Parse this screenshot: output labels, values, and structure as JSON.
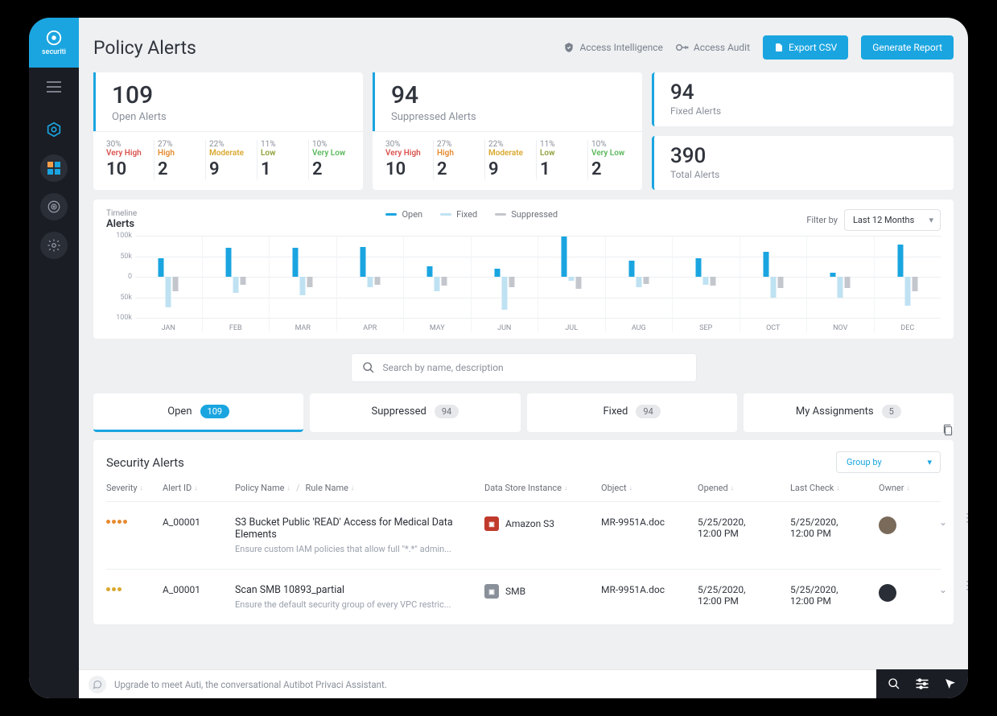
{
  "brand": "securiti",
  "page_title": "Policy Alerts",
  "header_links": {
    "access_intelligence": "Access Intelligence",
    "access_audit": "Access Audit"
  },
  "buttons": {
    "export_csv": "Export CSV",
    "generate_report": "Generate Report"
  },
  "summary": {
    "open": {
      "value": "109",
      "label": "Open Alerts"
    },
    "suppressed": {
      "value": "94",
      "label": "Suppressed Alerts"
    },
    "fixed": {
      "value": "94",
      "label": "Fixed Alerts"
    },
    "total": {
      "value": "390",
      "label": "Total Alerts"
    }
  },
  "severity_levels": [
    {
      "pct": "30%",
      "name": "Very High",
      "value": "10",
      "class": "c-veryhigh"
    },
    {
      "pct": "27%",
      "name": "High",
      "value": "2",
      "class": "c-high"
    },
    {
      "pct": "22%",
      "name": "Moderate",
      "value": "9",
      "class": "c-moderate"
    },
    {
      "pct": "11%",
      "name": "Low",
      "value": "1",
      "class": "c-low"
    },
    {
      "pct": "10%",
      "name": "Very Low",
      "value": "2",
      "class": "c-verylow"
    }
  ],
  "timeline": {
    "subtitle": "Timeline",
    "title": "Alerts",
    "legend": [
      {
        "name": "Open",
        "color": "#1aa5e0"
      },
      {
        "name": "Fixed",
        "color": "#bfe2f2"
      },
      {
        "name": "Suppressed",
        "color": "#c3c7cd"
      }
    ],
    "filter_label": "Filter by",
    "filter_value": "Last 12 Months",
    "y_ticks": [
      "100k",
      "50k",
      "0",
      "50k",
      "100k"
    ]
  },
  "chart_data": {
    "type": "bar",
    "title": "Timeline Alerts",
    "xlabel": "",
    "ylabel": "",
    "ylim": [
      -100,
      100
    ],
    "categories": [
      "JAN",
      "FEB",
      "MAR",
      "APR",
      "MAY",
      "JUN",
      "JUL",
      "AUG",
      "SEP",
      "OCT",
      "NOV",
      "DEC"
    ],
    "series": [
      {
        "name": "Open",
        "values": [
          45,
          70,
          70,
          72,
          25,
          20,
          98,
          40,
          45,
          60,
          10,
          78
        ]
      },
      {
        "name": "Fixed",
        "values": [
          -75,
          -40,
          -45,
          -25,
          -35,
          -80,
          -10,
          -25,
          -20,
          -50,
          -50,
          -70
        ]
      },
      {
        "name": "Suppressed",
        "values": [
          -35,
          -20,
          -25,
          -20,
          -22,
          -25,
          -30,
          -18,
          -22,
          -28,
          -28,
          -35
        ]
      }
    ]
  },
  "search_placeholder": "Search by name, description",
  "tabs": [
    {
      "label": "Open",
      "count": "109",
      "active": true
    },
    {
      "label": "Suppressed",
      "count": "94",
      "active": false
    },
    {
      "label": "Fixed",
      "count": "94",
      "active": false
    },
    {
      "label": "My Assignments",
      "count": "5",
      "active": false
    }
  ],
  "table": {
    "title": "Security Alerts",
    "group_by_label": "Group by",
    "columns": {
      "severity": "Severity",
      "alert_id": "Alert ID",
      "policy_name": "Policy Name",
      "rule_name": "Rule Name",
      "data_store": "Data Store Instance",
      "object": "Object",
      "opened": "Opened",
      "last_check": "Last Check",
      "owner": "Owner"
    },
    "rows": [
      {
        "severity_dots": 4,
        "severity_color": "#e68a2e",
        "alert_id": "A_00001",
        "policy_name": "S3 Bucket Public 'READ' Access for Medical Data Elements",
        "policy_desc": "Ensure custom IAM policies that allow full \"*.*\" admin...",
        "ds_name": "Amazon S3",
        "ds_color": "#c0392b",
        "object": "MR-9951A.doc",
        "opened": "5/25/2020, 12:00 PM",
        "last_check": "5/25/2020, 12:00 PM",
        "owner_bg": "#7a6a5a"
      },
      {
        "severity_dots": 3,
        "severity_color": "#d9a82e",
        "alert_id": "A_00001",
        "policy_name": "Scan SMB 10893_partial",
        "policy_desc": "Ensure the default security group of every VPC restric...",
        "ds_name": "SMB",
        "ds_color": "#8a909a",
        "object": "MR-9951A.doc",
        "opened": "5/25/2020, 12:00 PM",
        "last_check": "5/25/2020, 12:00 PM",
        "owner_bg": "#2a2e36"
      }
    ]
  },
  "footer_text": "Upgrade to meet Auti, the conversational Autibot Privaci Assistant."
}
